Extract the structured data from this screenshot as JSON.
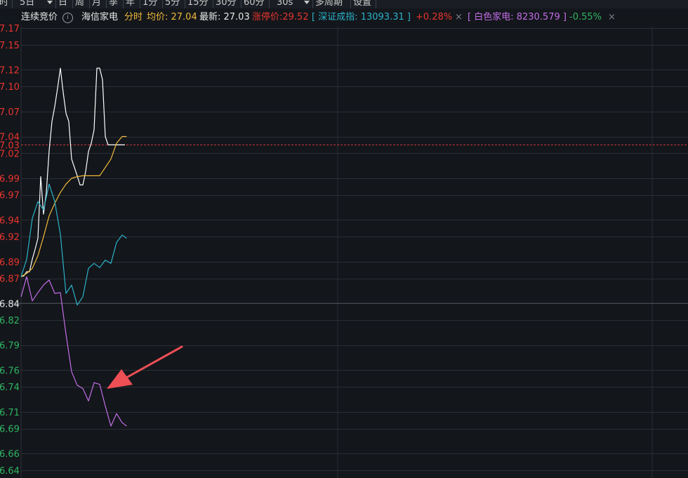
{
  "toolbar": {
    "items": [
      "时",
      "5日",
      "日",
      "周",
      "月",
      "季",
      "年",
      "1分",
      "5分",
      "15分",
      "30分",
      "60分",
      "30s",
      "多周期",
      "设置"
    ]
  },
  "infobar": {
    "auction_label": "连续竞价",
    "info_icon": "i",
    "stock_name": "海信家电",
    "mode": "分时",
    "avg_price": "均价: 27.04",
    "latest": "最新: 27.03",
    "limit_up": "涨停价:29.52",
    "index1": "[ 深证成指: 13093.31 ]",
    "index1_change": "+0.28%",
    "index2": "[ 白色家电: 8230.579 ]",
    "index2_change": "-0.55%",
    "close_symbol": "×"
  },
  "colors": {
    "background": "#13161b",
    "up": "#e8352e",
    "down": "#2fb462",
    "price_line": "#ffffff",
    "avg_line": "#f0b93a",
    "index1_line": "#2bb3c9",
    "index2_line": "#c36ee8",
    "arrow": "#ee4f55",
    "info_index1": "#2bb3c9",
    "info_index2": "#c36ee8"
  },
  "chart_data": {
    "type": "line",
    "y_tick_labels_up": [
      "7.17",
      "7.15",
      "7.12",
      "7.10",
      "7.07",
      "7.04",
      "7.03",
      "7.02",
      "6.99",
      "6.97",
      "6.94",
      "6.92",
      "6.89",
      "6.87"
    ],
    "y_tick_label_mid": "6.84",
    "y_tick_labels_down": [
      "6.82",
      "6.79",
      "6.76",
      "6.74",
      "6.71",
      "6.69",
      "6.66",
      "6.64"
    ],
    "ylim": [
      6.635,
      7.175
    ],
    "current_price_marker": 27.03,
    "x_range_minutes": [
      0,
      1200
    ],
    "series": [
      {
        "name": "海信家电",
        "x": [
          0,
          5,
          10,
          15,
          20,
          25,
          30,
          35,
          40,
          45,
          50,
          55,
          60,
          65,
          70,
          75,
          80,
          85,
          90,
          95,
          100,
          105,
          110,
          115,
          120,
          125,
          130,
          135,
          140,
          145,
          150,
          155,
          160,
          165,
          170,
          175,
          180,
          185
        ],
        "y": [
          6.872,
          6.873,
          6.878,
          6.878,
          6.893,
          6.905,
          6.918,
          6.992,
          6.947,
          6.973,
          7.023,
          7.058,
          7.076,
          7.098,
          7.122,
          7.093,
          7.068,
          7.058,
          7.013,
          7.003,
          6.993,
          6.982,
          6.982,
          6.998,
          7.022,
          7.032,
          7.048,
          7.122,
          7.122,
          7.108,
          7.04,
          7.03,
          7.03,
          7.03,
          7.03,
          7.03,
          7.03,
          7.03
        ]
      },
      {
        "name": "均价",
        "x": [
          0,
          10,
          20,
          30,
          40,
          50,
          60,
          70,
          80,
          90,
          100,
          110,
          120,
          130,
          140,
          150,
          160,
          170,
          180,
          188
        ],
        "y": [
          6.872,
          6.876,
          6.882,
          6.897,
          6.92,
          6.945,
          6.96,
          6.973,
          6.983,
          6.99,
          6.992,
          6.993,
          6.993,
          6.993,
          6.993,
          7.003,
          7.013,
          7.032,
          7.04,
          7.04
        ]
      },
      {
        "name": "深证成指",
        "x": [
          0,
          10,
          20,
          30,
          40,
          50,
          60,
          70,
          80,
          90,
          100,
          110,
          120,
          130,
          140,
          150,
          160,
          170,
          180,
          188
        ],
        "y": [
          6.872,
          6.893,
          6.942,
          6.962,
          6.952,
          6.983,
          6.962,
          6.923,
          6.852,
          6.862,
          6.838,
          6.848,
          6.882,
          6.888,
          6.883,
          6.892,
          6.888,
          6.913,
          6.922,
          6.918
        ]
      },
      {
        "name": "白色家电",
        "x": [
          0,
          10,
          20,
          30,
          40,
          50,
          60,
          70,
          80,
          90,
          100,
          110,
          120,
          130,
          140,
          150,
          160,
          170,
          180,
          188
        ],
        "y": [
          6.848,
          6.872,
          6.843,
          6.853,
          6.862,
          6.868,
          6.852,
          6.853,
          6.803,
          6.758,
          6.742,
          6.738,
          6.723,
          6.745,
          6.743,
          6.717,
          6.693,
          6.708,
          6.697,
          6.693
        ]
      }
    ],
    "annotation": "arrow pointing to 白色家电 line"
  }
}
